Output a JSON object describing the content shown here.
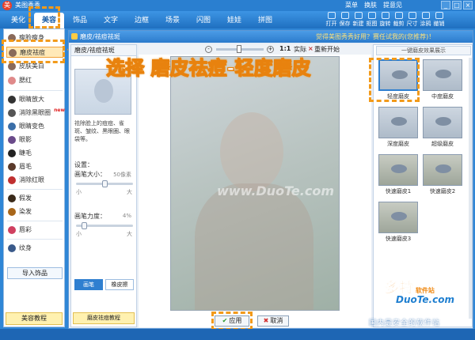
{
  "app": {
    "title": "美图秀秀",
    "menu": [
      "菜单",
      "换肤",
      "提意见"
    ],
    "window_controls": [
      "_",
      "□",
      "×"
    ]
  },
  "tabs": [
    "美化",
    "美容",
    "饰品",
    "文字",
    "边框",
    "场景",
    "闪图",
    "娃娃",
    "拼图"
  ],
  "active_tab": "美容",
  "toolbar": [
    "打开",
    "保存",
    "新建",
    "抠图",
    "旋转",
    "裁剪",
    "尺寸",
    "涂鸦",
    "撤销"
  ],
  "sidebar": {
    "items": [
      "瘦脸瘦身",
      "磨皮祛痘",
      "皮肤美白",
      "腮红",
      "眼睛放大",
      "消除黑眼圈",
      "眼睛变色",
      "眼影",
      "睫毛",
      "眉毛",
      "消除红眼",
      "假发",
      "染发",
      "唇彩",
      "纹身"
    ],
    "active": "磨皮祛痘",
    "new_badge": "new",
    "import_label": "导入饰品",
    "tutorial_label": "美容教程"
  },
  "dialog": {
    "title": "磨皮/祛痘祛斑",
    "promo": "觉得美图秀秀好用？赛任试我的(您推荐)！",
    "caption": "选择 磨皮祛痘-轻度磨皮"
  },
  "panel": {
    "header": "磨皮/祛痘祛斑",
    "description": "祛除脸上的痘痘、雀斑、皱纹、黑眼圈、眼袋等。",
    "settings_label": "设置：",
    "brush_size_label": "画笔大小：",
    "brush_size_value": "50像素",
    "brush_strength_label": "画笔力度：",
    "brush_strength_value": "4%",
    "brush_size_fraction": 0.5,
    "brush_strength_fraction": 0.1,
    "min_label": "小",
    "max_label": "大",
    "brush_mode": "画笔",
    "eraser_mode": "橡皮擦",
    "tutorial_label": "磨皮祛痘教程"
  },
  "canvas": {
    "zoom_ratio": "1:1",
    "zoom_label": "实际",
    "restart_label": "重新开始",
    "watermark": "www.DuoTe.com",
    "apply_label": "应用",
    "cancel_label": "取消"
  },
  "presets": {
    "header": "一键磨皮效果展示",
    "items": [
      "轻度磨皮",
      "中度磨皮",
      "深度磨皮",
      "超级磨皮",
      "快速磨皮1",
      "快速磨皮2",
      "快速磨皮3"
    ],
    "selected": "轻度磨皮"
  },
  "branding": {
    "site_name": "多特",
    "site_tag": "软件站",
    "site_domain": "DuoTe.com",
    "slogan": "国内最安全的软件站"
  },
  "colors": {
    "accent": "#2f7fd0",
    "highlight": "#f29a1a"
  }
}
